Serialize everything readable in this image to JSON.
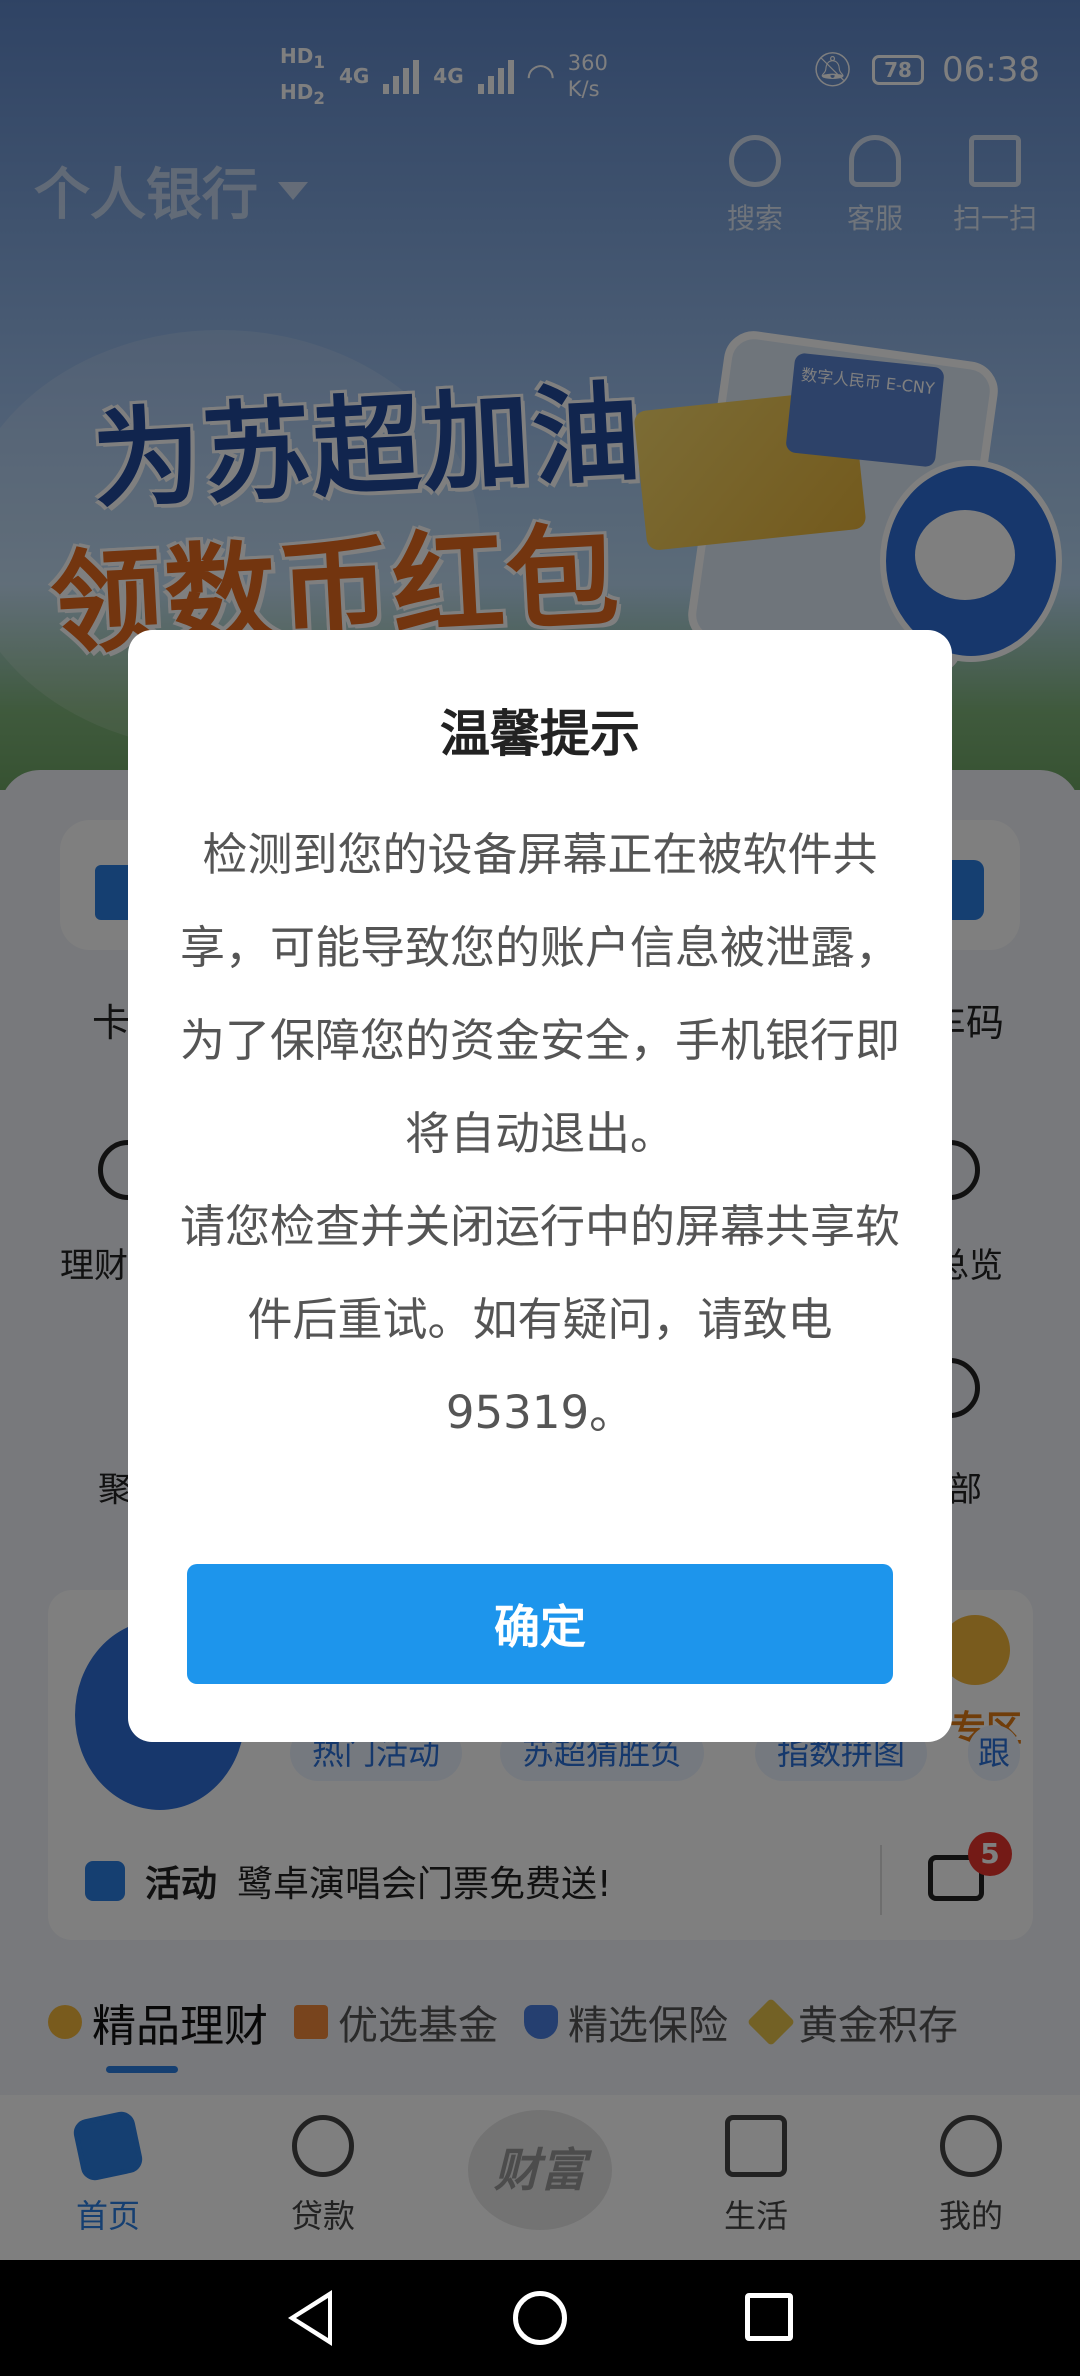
{
  "status_bar": {
    "hd1": "HD",
    "hd1_sub": "1",
    "hd2": "HD",
    "hd2_sub": "2",
    "net1": "4G",
    "net2": "4G",
    "speed_value": "360",
    "speed_unit": "K/s",
    "battery": "78",
    "time": "06:38"
  },
  "header": {
    "brand": "个人银行",
    "actions": [
      "搜索",
      "客服",
      "扫一扫"
    ]
  },
  "banner": {
    "line1": "为苏超加油",
    "line2": "领数币红包",
    "card_text": "数字人民币 E-CNY"
  },
  "quick_partial": {
    "left": "卡",
    "right": "乘车码"
  },
  "grid_partial": {
    "row1_left": "理财",
    "row1_right": "总览",
    "row2_left": "聚",
    "row2_right": "部"
  },
  "activity": {
    "pills": [
      "热门活动",
      "苏超猜胜负",
      "指数拼图",
      "跟"
    ],
    "zone_label": "专区",
    "notice_tag": "活动",
    "notice_text": "鹭卓演唱会门票免费送!",
    "message_badge": "5"
  },
  "category_tabs": [
    "精品理财",
    "优选基金",
    "精选保险",
    "黄金积存"
  ],
  "bottom_nav": {
    "items": [
      "首页",
      "贷款",
      "财富",
      "生活",
      "我的"
    ],
    "active_index": 0
  },
  "dialog": {
    "title": "温馨提示",
    "paragraph1": "检测到您的设备屏幕正在被软件共享，可能导致您的账户信息被泄露，为了保障您的资金安全，手机银行即将自动退出。",
    "paragraph2": "请您检查并关闭运行中的屏幕共享软件后重试。如有疑问，请致电95319。",
    "confirm_label": "确定"
  },
  "colors": {
    "primary": "#1d95ec",
    "badge": "#e8342d",
    "overlay": "rgba(0,0,0,0.5)"
  }
}
